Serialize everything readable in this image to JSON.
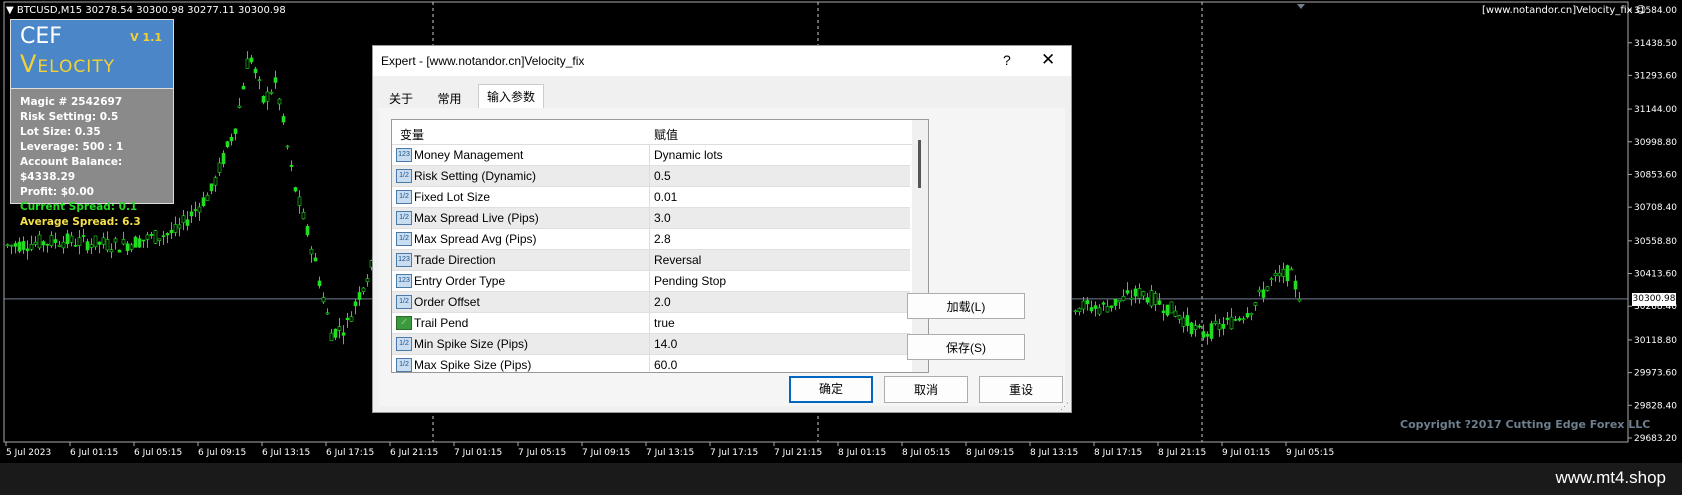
{
  "chart": {
    "header": "BTCUSD,M15  30278.54 30300.98 30277.11 30300.98",
    "ea_label": "[www.notandor.cn]Velocity_fix",
    "current_price": "30300.98",
    "price_levels": [
      "31584.00",
      "31438.50",
      "31293.60",
      "31144.00",
      "30998.80",
      "30853.60",
      "30708.40",
      "30558.80",
      "30413.60",
      "30268.40",
      "30118.80",
      "29973.60",
      "29828.40",
      "29683.20"
    ],
    "time_labels": [
      "5 Jul 2023",
      "6 Jul 01:15",
      "6 Jul 05:15",
      "6 Jul 09:15",
      "6 Jul 13:15",
      "6 Jul 17:15",
      "6 Jul 21:15",
      "7 Jul 01:15",
      "7 Jul 05:15",
      "7 Jul 09:15",
      "7 Jul 13:15",
      "7 Jul 17:15",
      "7 Jul 21:15",
      "8 Jul 01:15",
      "8 Jul 05:15",
      "8 Jul 09:15",
      "8 Jul 13:15",
      "8 Jul 17:15",
      "8 Jul 21:15",
      "9 Jul 01:15",
      "9 Jul 05:15"
    ],
    "copyright": "Copyright ?2017 Cutting Edge Forex LLC",
    "watermark": "www.mt4.shop",
    "colors": {
      "up": "#22dd22",
      "down": "#22dd22",
      "bg": "#000000"
    }
  },
  "panel": {
    "title1": "CEF",
    "title2": "Velocity",
    "version": "V 1.1",
    "magic": "Magic # 2542697",
    "risk": "Risk Setting: 0.5",
    "lot": "Lot Size: 0.35",
    "leverage": "Leverage: 500 : 1",
    "balance": "Account Balance: $4338.29",
    "profit": "Profit: $0.00",
    "current_spread": "Current Spread:  0.1",
    "average_spread": "Average Spread:  6.3"
  },
  "dialog": {
    "title": "Expert - [www.notandor.cn]Velocity_fix",
    "help": "?",
    "tabs": [
      "关于",
      "常用",
      "输入参数"
    ],
    "col_variable": "变量",
    "col_value": "赋值",
    "rows": [
      {
        "icon": "123",
        "name": "Money Management",
        "value": "Dynamic lots"
      },
      {
        "icon": "1/2",
        "name": "Risk Setting   (Dynamic)",
        "value": "0.5"
      },
      {
        "icon": "1/2",
        "name": "Fixed Lot Size",
        "value": "0.01"
      },
      {
        "icon": "1/2",
        "name": "Max Spread Live  (Pips)",
        "value": "3.0"
      },
      {
        "icon": "1/2",
        "name": "Max Spread Avg   (Pips)",
        "value": "2.8"
      },
      {
        "icon": "123",
        "name": "Trade Direction",
        "value": "Reversal"
      },
      {
        "icon": "123",
        "name": "Entry Order Type",
        "value": "Pending Stop"
      },
      {
        "icon": "1/2",
        "name": "Order Offset",
        "value": "2.0"
      },
      {
        "icon": "bool",
        "name": "Trail Pend",
        "value": "true"
      },
      {
        "icon": "1/2",
        "name": "Min Spike Size   (Pips)",
        "value": "14.0"
      },
      {
        "icon": "1/2",
        "name": "Max Spike Size   (Pips)",
        "value": "60.0"
      }
    ],
    "load_button": "加载(L)",
    "save_button": "保存(S)",
    "ok_button": "确定",
    "cancel_button": "取消",
    "reset_button": "重设"
  }
}
